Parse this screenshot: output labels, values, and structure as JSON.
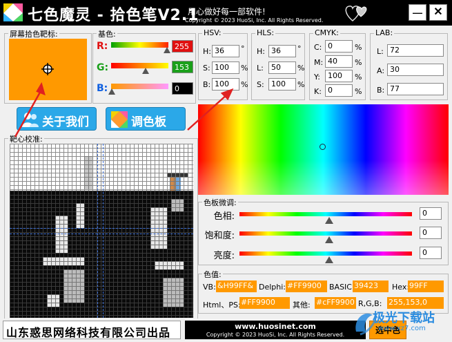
{
  "titlebar": {
    "app_title": "七色魔灵 - 拾色笔V2.1",
    "slogan": "用心做好每一部软件!",
    "copyright": "Copyright © 2023 HuoSi, Inc. All Rights Reserved.",
    "minimize": "—",
    "close": "✕"
  },
  "target": {
    "title": "屏幕拾色靶标:",
    "color": "#ff9900"
  },
  "basic": {
    "title": "基色:",
    "r_label": "R:",
    "r_value": "255",
    "g_label": "G:",
    "g_value": "153",
    "b_label": "B:",
    "b_value": "0"
  },
  "hsv": {
    "title": "HSV:",
    "h_label": "H:",
    "h": "36",
    "s_label": "S:",
    "s": "100",
    "b_label": "B:",
    "b": "100",
    "deg": "°",
    "pct": "%"
  },
  "hls": {
    "title": "HLS:",
    "h_label": "H:",
    "h": "36",
    "l_label": "L:",
    "l": "50",
    "s_label": "S:",
    "s": "100",
    "deg": "°",
    "pct": "%"
  },
  "cmyk": {
    "title": "CMYK:",
    "c_label": "C:",
    "c": "0",
    "m_label": "M:",
    "m": "40",
    "y_label": "Y:",
    "y": "100",
    "k_label": "K:",
    "k": "0",
    "pct": "%"
  },
  "lab": {
    "title": "LAB:",
    "l_label": "L:",
    "l": "72",
    "a_label": "A:",
    "a": "30",
    "b_label": "B:",
    "b": "77"
  },
  "buttons": {
    "about": "关于我们",
    "palette": "调色板"
  },
  "magnifier": {
    "title": "靶心校准:"
  },
  "tuning": {
    "title": "色板微调:",
    "hue": "色相:",
    "saturation": "饱和度:",
    "brightness": "亮度:",
    "hue_value": "0",
    "sat_value": "0",
    "bri_value": "0"
  },
  "values": {
    "title": "色值:",
    "vb_label": "VB:",
    "vb": "&H99FF&",
    "delphi_label": "Delphi:",
    "delphi": "#FF9900",
    "basic_label": "BASIC:",
    "basic": "39423",
    "hex_label": "Hex:",
    "hex": "99FF",
    "html_label": "Html、PS:",
    "html": "#FF9900",
    "other_label": "其他:",
    "other": "#cFF9900",
    "rgb_label": "R,G,B:",
    "rgb": "255,153,0"
  },
  "footer": {
    "company": "山东惑思网络科技有限公司出品",
    "url": "www.huosinet.com",
    "copyright": "Copyright © 2023 HuoSi, Inc. All Rights Reserved.",
    "ok": "选中色"
  },
  "watermark": {
    "text": "极光下载站",
    "url": "www.xz7.com"
  },
  "colors": {
    "accent": "#ff9900",
    "button_blue": "#2ba8e8",
    "arrow_red": "#e02020"
  }
}
